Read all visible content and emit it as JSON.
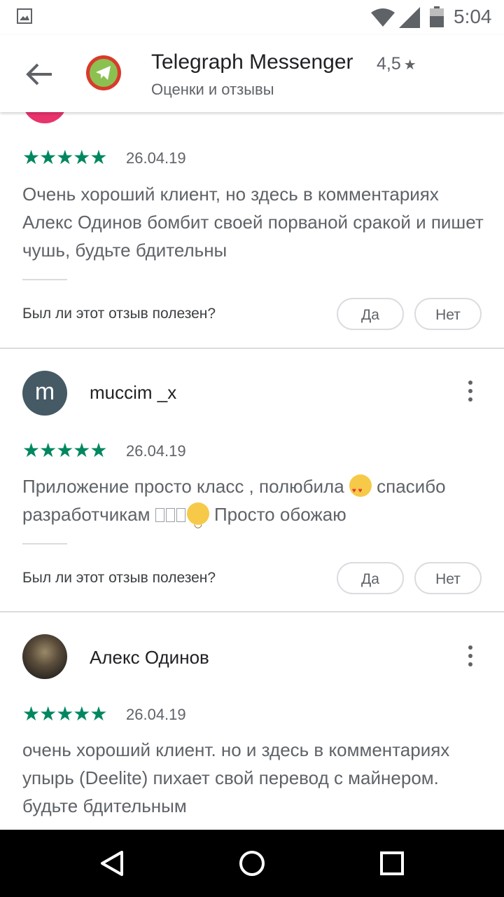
{
  "status_bar": {
    "time": "5:04"
  },
  "app_header": {
    "title": "Telegraph Messenger",
    "rating": "4,5",
    "subtitle": "Оценки и отзывы"
  },
  "reviews": [
    {
      "author": "",
      "stars": "★★★★★",
      "date": "26.04.19",
      "text": "Очень хороший клиент, но здесь в комментариях Алекс Одинов бомбит своей порваной сракой и пишет чушь, будьте бдительны",
      "helpful_question": "Был ли этот отзыв полезен?",
      "yes_label": "Да",
      "no_label": "Нет"
    },
    {
      "author": "muccim _x",
      "avatar_letter": "m",
      "stars": "★★★★★",
      "date": "26.04.19",
      "text_part1": "Приложение просто класс , полюбила ",
      "text_part2": " спасибо разработчикам ",
      "text_part3": " Просто обожаю",
      "helpful_question": "Был ли этот отзыв полезен?",
      "yes_label": "Да",
      "no_label": "Нет"
    },
    {
      "author": "Алекс Одинов",
      "stars": "★★★★★",
      "date": "26.04.19",
      "text": "очень хороший клиент. но и здесь в комментариях упырь (Deelite) пихает свой перевод с майнером. будьте бдительным"
    }
  ],
  "colors": {
    "star_green": "#01875f",
    "avatar_pink": "#e8336d",
    "avatar_slate": "#455a64"
  }
}
